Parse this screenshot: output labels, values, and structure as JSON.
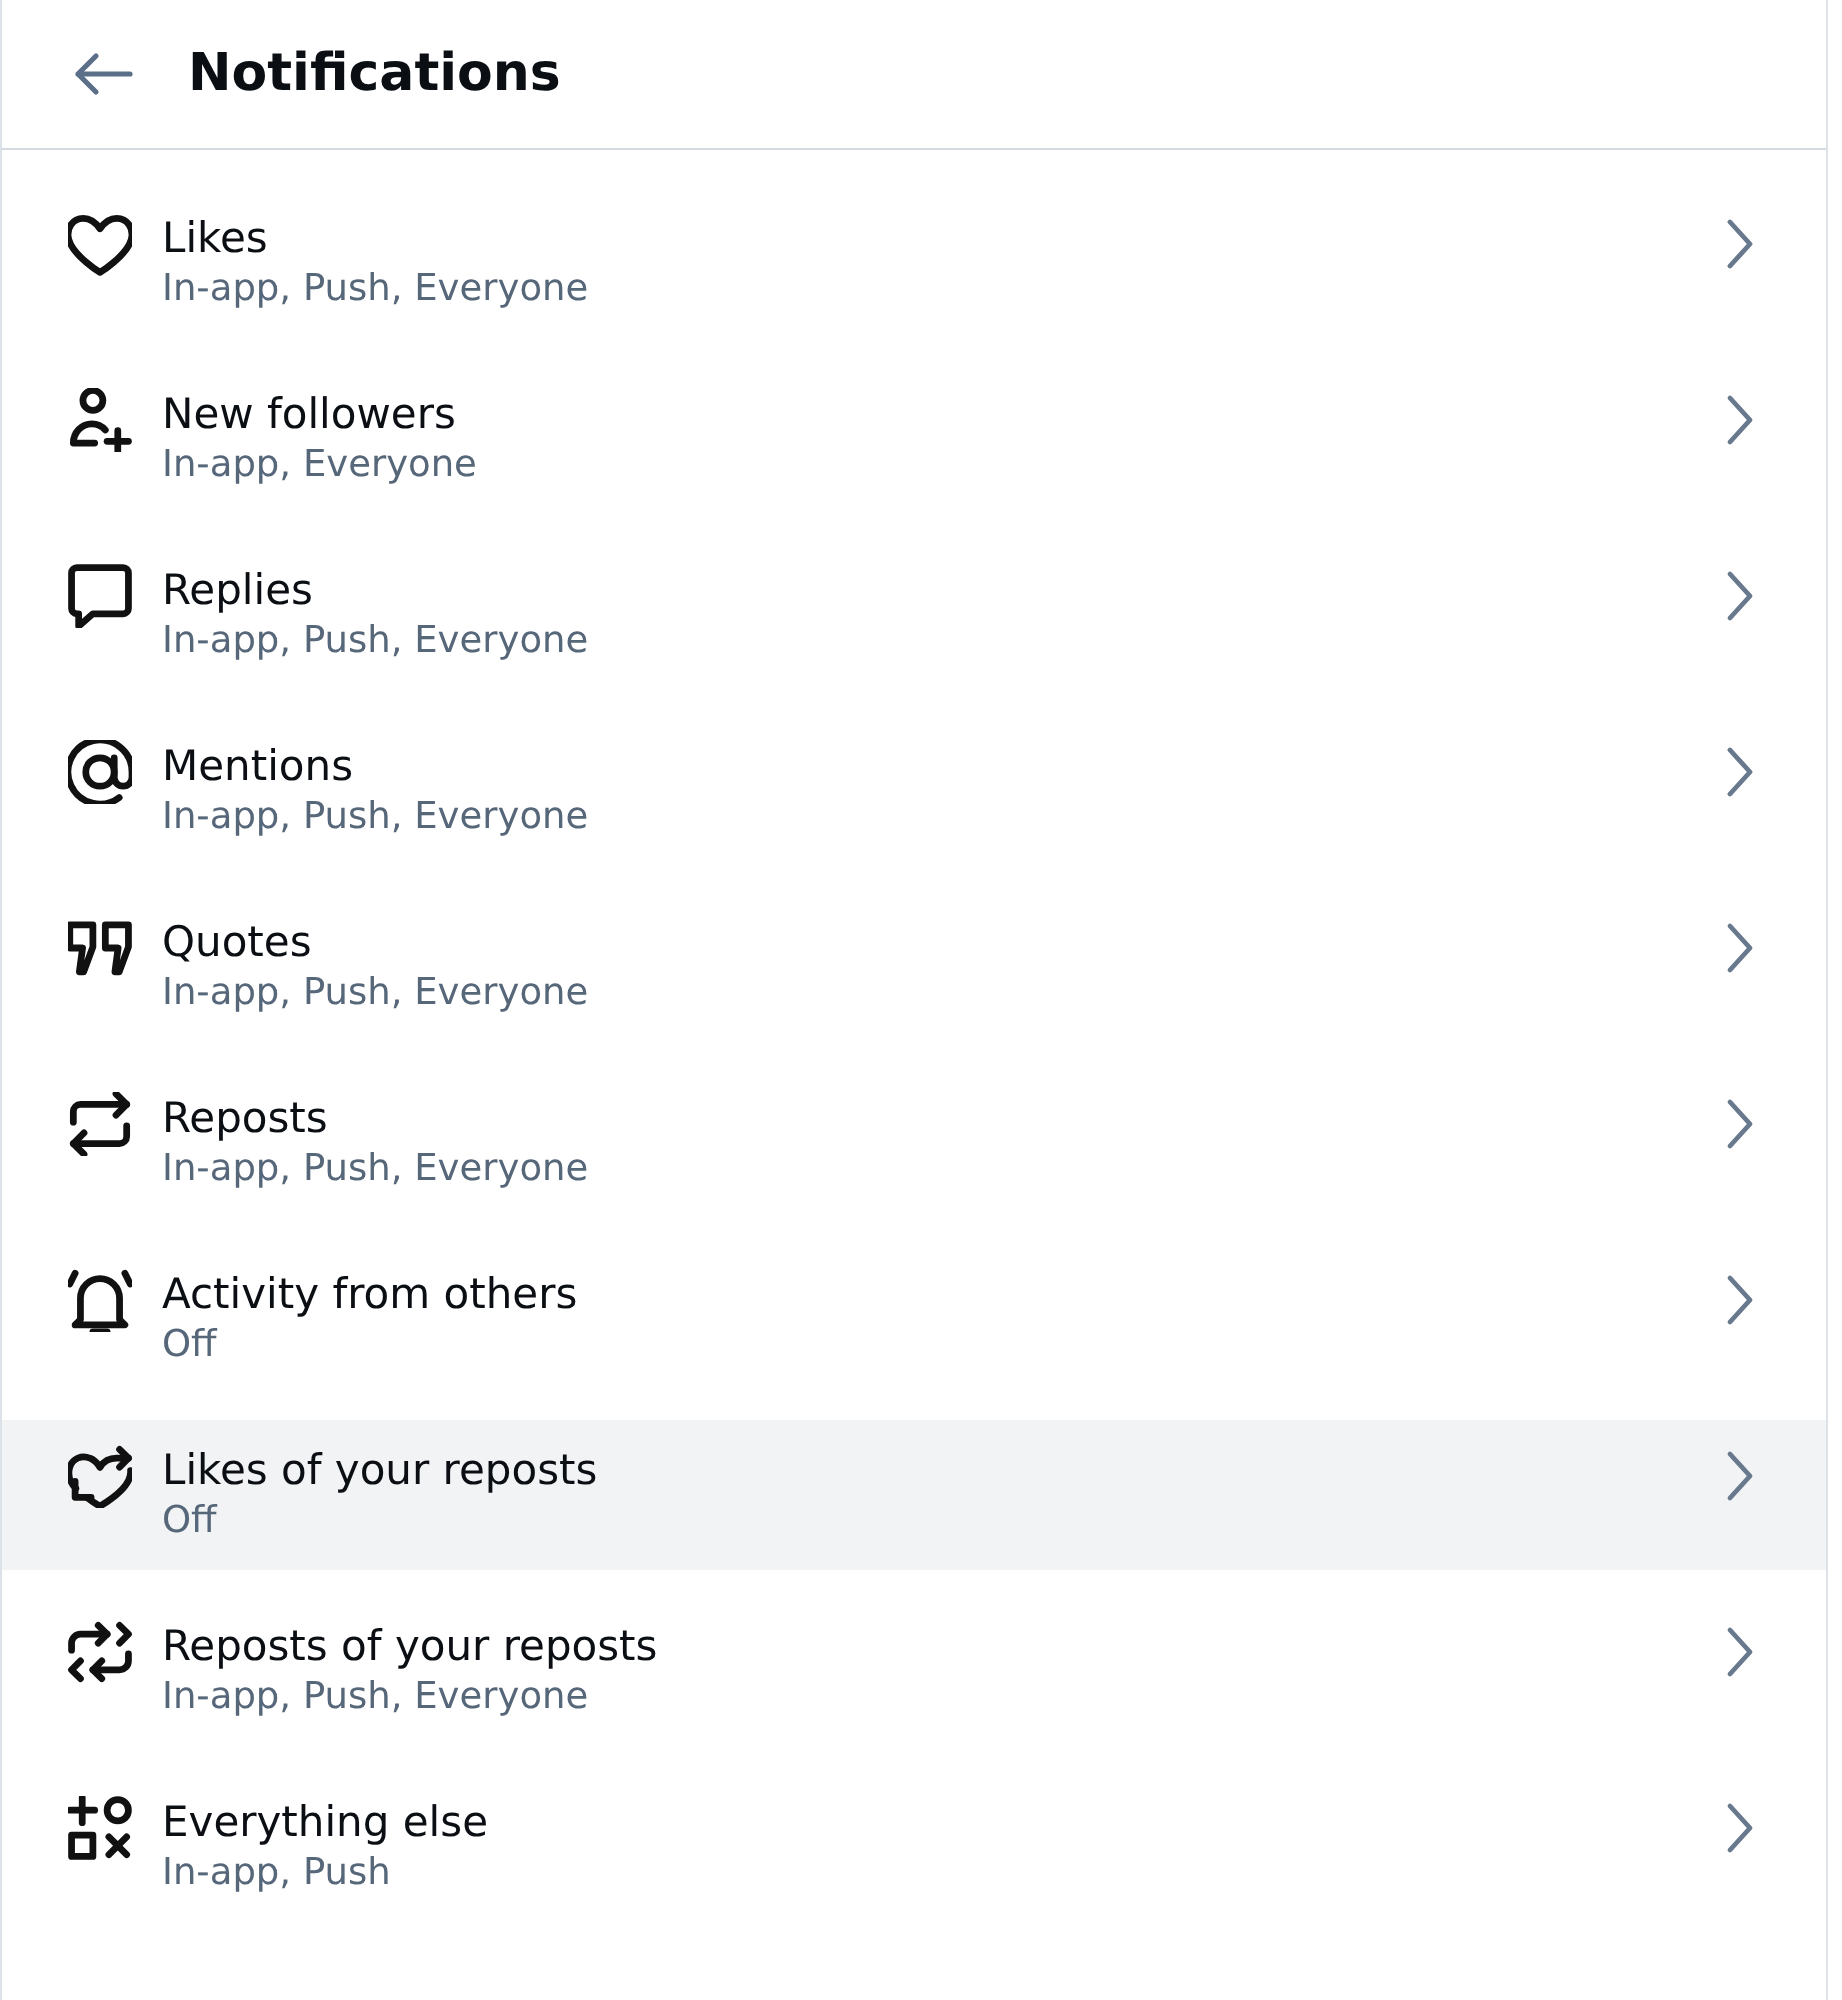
{
  "header": {
    "title": "Notifications"
  },
  "items": [
    {
      "label": "Likes",
      "summary": "In-app, Push, Everyone",
      "selected": false
    },
    {
      "label": "New followers",
      "summary": "In-app, Everyone",
      "selected": false
    },
    {
      "label": "Replies",
      "summary": "In-app, Push, Everyone",
      "selected": false
    },
    {
      "label": "Mentions",
      "summary": "In-app, Push, Everyone",
      "selected": false
    },
    {
      "label": "Quotes",
      "summary": "In-app, Push, Everyone",
      "selected": false
    },
    {
      "label": "Reposts",
      "summary": "In-app, Push, Everyone",
      "selected": false
    },
    {
      "label": "Activity from others",
      "summary": "Off",
      "selected": false
    },
    {
      "label": "Likes of your reposts",
      "summary": "Off",
      "selected": true
    },
    {
      "label": "Reposts of your reposts",
      "summary": "In-app, Push, Everyone",
      "selected": false
    },
    {
      "label": "Everything else",
      "summary": "In-app, Push",
      "selected": false
    }
  ]
}
